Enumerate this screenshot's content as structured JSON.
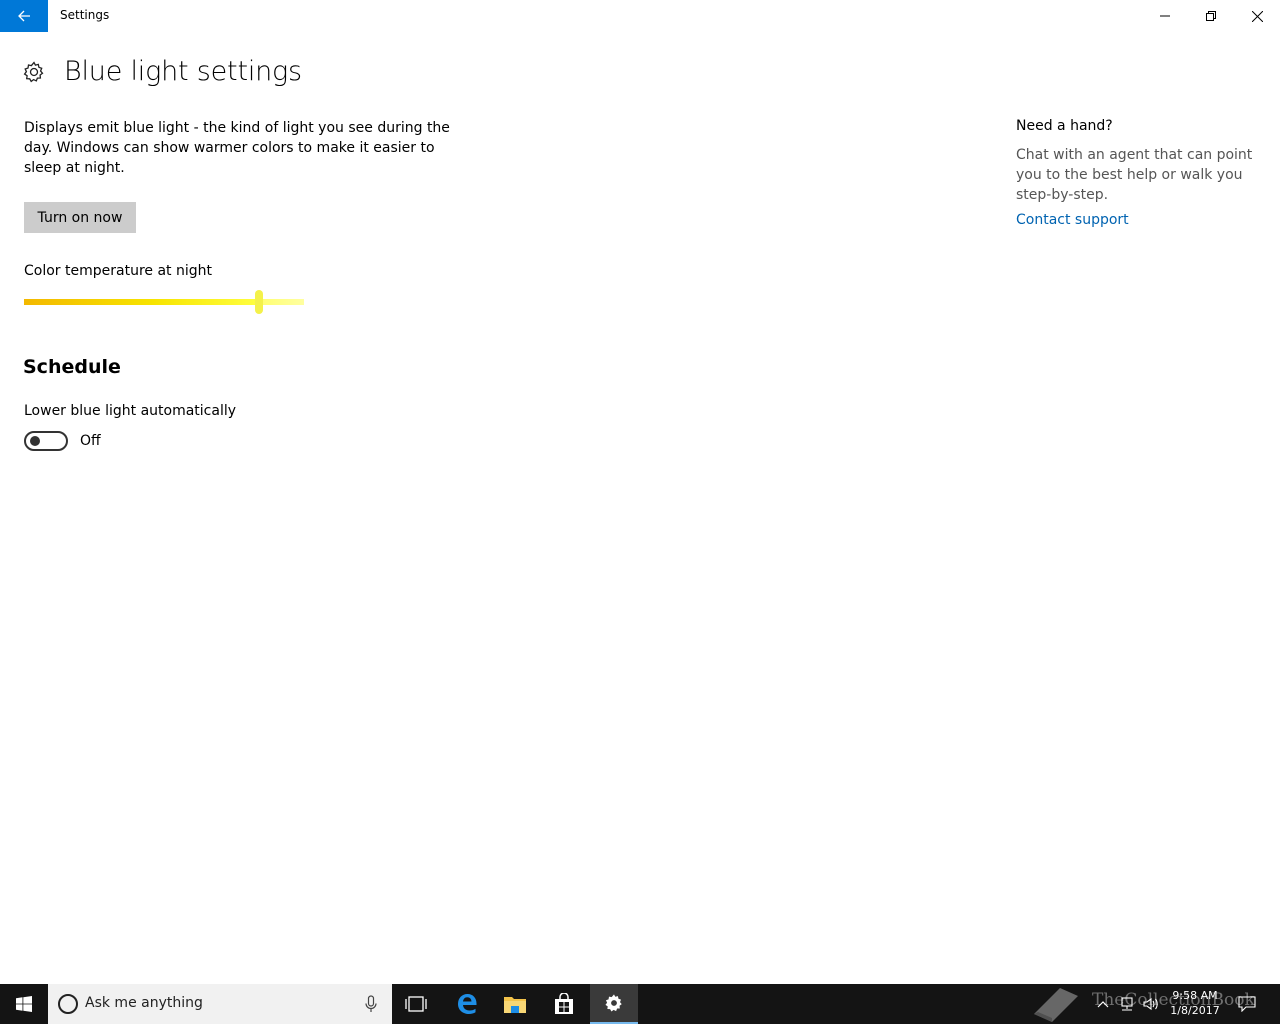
{
  "window": {
    "title": "Settings"
  },
  "page": {
    "title": "Blue light settings",
    "description": "Displays emit blue light - the kind of light you see during the day. Windows can show warmer colors to make it easier to sleep at night.",
    "turn_on_button": "Turn on now",
    "slider_label": "Color temperature at night",
    "slider_value": 0.84,
    "schedule_title": "Schedule",
    "toggle_label": "Lower blue light automatically",
    "toggle_state": "Off"
  },
  "help": {
    "title": "Need a hand?",
    "text": "Chat with an agent that can point you to the best help or walk you step-by-step.",
    "link": "Contact support"
  },
  "taskbar": {
    "search_placeholder": "Ask me anything",
    "clock_time": "9:58 AM",
    "clock_date": "1/8/2017",
    "watermark": "TheCollectionBook",
    "items": [
      "task-view-icon",
      "edge-icon",
      "file-explorer-icon",
      "store-icon",
      "settings-icon"
    ]
  },
  "colors": {
    "accent": "#0078d7",
    "link": "#0063b1",
    "button_bg": "#cccccc",
    "taskbar_bg": "#141414"
  }
}
